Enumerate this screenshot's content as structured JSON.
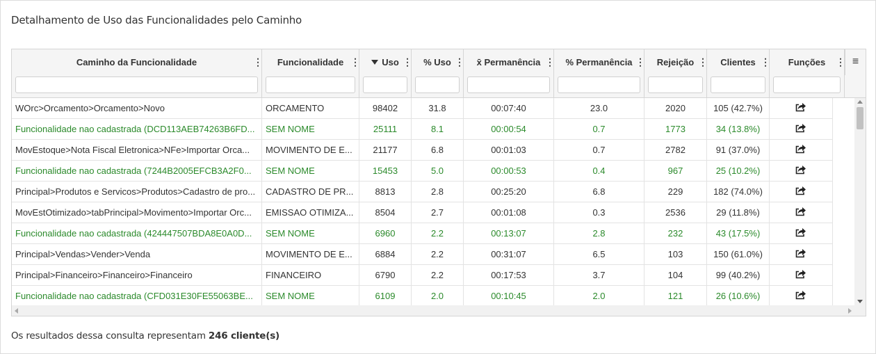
{
  "title": "Detalhamento de Uso das Funcionalidades pelo Caminho",
  "menu_glyph": "⋮",
  "grid_menu_glyph": "≡",
  "columns": [
    {
      "key": "caminho",
      "label": "Caminho da Funcionalidade"
    },
    {
      "key": "func",
      "label": "Funcionalidade"
    },
    {
      "key": "uso",
      "label": "Uso",
      "sorted": "desc"
    },
    {
      "key": "pctuso",
      "label": "% Uso"
    },
    {
      "key": "perm",
      "label": "x̄ Permanência"
    },
    {
      "key": "pctperm",
      "label": "% Permanência"
    },
    {
      "key": "rej",
      "label": "Rejeição"
    },
    {
      "key": "cli",
      "label": "Clientes"
    },
    {
      "key": "fn",
      "label": "Funções"
    }
  ],
  "rows": [
    {
      "caminho": "WOrc>Orcamento>Orcamento>Novo",
      "func": "ORCAMENTO",
      "uso": "98402",
      "pctuso": "31.8",
      "perm": "00:07:40",
      "pctperm": "23.0",
      "rej": "2020",
      "cli": "105 (42.7%)",
      "green": false
    },
    {
      "caminho": "Funcionalidade nao cadastrada (DCD113AEB74263B6FD...",
      "func": "SEM NOME",
      "uso": "25111",
      "pctuso": "8.1",
      "perm": "00:00:54",
      "pctperm": "0.7",
      "rej": "1773",
      "cli": "34 (13.8%)",
      "green": true
    },
    {
      "caminho": "MovEstoque>Nota Fiscal Eletronica>NFe>Importar Orca...",
      "func": "MOVIMENTO DE E...",
      "uso": "21177",
      "pctuso": "6.8",
      "perm": "00:01:03",
      "pctperm": "0.7",
      "rej": "2782",
      "cli": "91 (37.0%)",
      "green": false
    },
    {
      "caminho": "Funcionalidade nao cadastrada (7244B2005EFCB3A2F0...",
      "func": "SEM NOME",
      "uso": "15453",
      "pctuso": "5.0",
      "perm": "00:00:53",
      "pctperm": "0.4",
      "rej": "967",
      "cli": "25 (10.2%)",
      "green": true
    },
    {
      "caminho": "Principal>Produtos e Servicos>Produtos>Cadastro de pro...",
      "func": "CADASTRO DE PR...",
      "uso": "8813",
      "pctuso": "2.8",
      "perm": "00:25:20",
      "pctperm": "6.8",
      "rej": "229",
      "cli": "182 (74.0%)",
      "green": false
    },
    {
      "caminho": "MovEstOtimizado>tabPrincipal>Movimento>Importar Orc...",
      "func": "EMISSAO OTIMIZA...",
      "uso": "8504",
      "pctuso": "2.7",
      "perm": "00:01:08",
      "pctperm": "0.3",
      "rej": "2536",
      "cli": "29 (11.8%)",
      "green": false
    },
    {
      "caminho": "Funcionalidade nao cadastrada (424447507BDA8E0A0D...",
      "func": "SEM NOME",
      "uso": "6960",
      "pctuso": "2.2",
      "perm": "00:13:07",
      "pctperm": "2.8",
      "rej": "232",
      "cli": "43 (17.5%)",
      "green": true
    },
    {
      "caminho": "Principal>Vendas>Vender>Venda",
      "func": "MOVIMENTO DE E...",
      "uso": "6884",
      "pctuso": "2.2",
      "perm": "00:31:07",
      "pctperm": "6.5",
      "rej": "103",
      "cli": "150 (61.0%)",
      "green": false
    },
    {
      "caminho": "Principal>Financeiro>Financeiro>Financeiro",
      "func": "FINANCEIRO",
      "uso": "6790",
      "pctuso": "2.2",
      "perm": "00:17:53",
      "pctperm": "3.7",
      "rej": "104",
      "cli": "99 (40.2%)",
      "green": false
    },
    {
      "caminho": "Funcionalidade nao cadastrada (CFD031E30FE55063BE...",
      "func": "SEM NOME",
      "uso": "6109",
      "pctuso": "2.0",
      "perm": "00:10:45",
      "pctperm": "2.0",
      "rej": "121",
      "cli": "26 (10.6%)",
      "green": true
    }
  ],
  "footer": {
    "prefix": "Os resultados dessa consulta representam",
    "count": "246 cliente(s)"
  },
  "colors": {
    "green": "#2b8a2b",
    "header_bg": "#f5f5f5"
  }
}
